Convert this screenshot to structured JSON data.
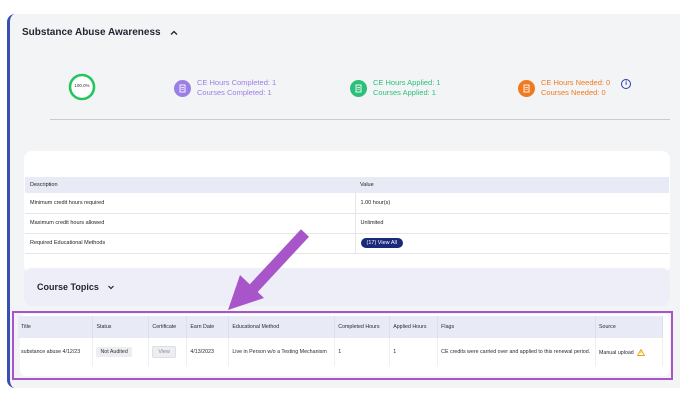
{
  "section": {
    "title": "Substance Abuse Awareness"
  },
  "progress": {
    "percent_label": "100.0%",
    "value": 1.0,
    "color": "#22c55e"
  },
  "stats": {
    "completed": {
      "hours": "CE Hours Completed: 1",
      "courses": "Courses Completed: 1",
      "color": "#9b7fe6"
    },
    "applied": {
      "hours": "CE Hours Applied: 1",
      "courses": "Courses Applied: 1",
      "color": "#2bbf7a"
    },
    "needed": {
      "hours": "CE Hours Needed: 0",
      "courses": "Courses Needed: 0",
      "color": "#f07a22"
    }
  },
  "requirements": {
    "headers": [
      "Description",
      "Value"
    ],
    "rows": [
      {
        "desc": "Minimum credit hours required",
        "value": "1.00 hour(s)"
      },
      {
        "desc": "Maximum credit hours allowed",
        "value": "Unlimited"
      },
      {
        "desc": "Required Educational Methods",
        "value": "(17) View All"
      }
    ]
  },
  "course_topics": {
    "title": "Course Topics"
  },
  "courses": {
    "headers": [
      "Title",
      "Status",
      "Certificate",
      "Earn Date",
      "Educational Method",
      "Completed Hours",
      "Applied Hours",
      "Flags",
      "Source"
    ],
    "rows": [
      {
        "title": "substance abuse 4/12/23",
        "status": "Not Audited",
        "certificate": "View",
        "earn_date": "4/13/2023",
        "method": "Live in Person w/o a Testing Mechanism",
        "completed": "1",
        "applied": "1",
        "flags": "CE credits were carried over and applied to this renewal period.",
        "source": "Manual upload"
      }
    ]
  },
  "annotation": {
    "arrow_color": "#a855c9"
  }
}
